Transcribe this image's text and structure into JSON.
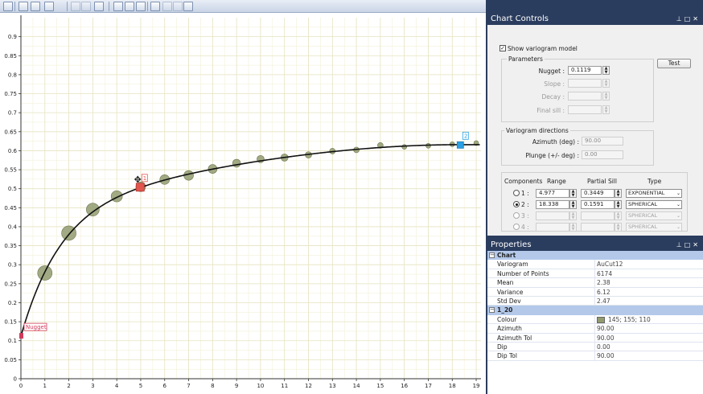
{
  "toolbar": {
    "buttons": [
      "layout-icon",
      "properties-icon",
      "chart-type-icon",
      "grid-icon",
      "copy-icon",
      "paste-icon",
      "export-icon",
      "select-pointer-icon",
      "pan-hand-icon",
      "zoom-icon",
      "variogram-icon",
      "undo-icon",
      "redo-icon",
      "fit-icon"
    ]
  },
  "chart_data": {
    "type": "scatter",
    "title": "",
    "xlabel": "",
    "ylabel": "",
    "xlim": [
      0,
      19.2
    ],
    "ylim": [
      0,
      0.95
    ],
    "x_ticks": [
      0,
      1,
      2,
      3,
      4,
      5,
      6,
      7,
      8,
      9,
      10,
      11,
      12,
      13,
      14,
      15,
      16,
      17,
      18,
      19
    ],
    "y_ticks": [
      0,
      0.05,
      0.1,
      0.15,
      0.2,
      0.25,
      0.3,
      0.35,
      0.4,
      0.45,
      0.5,
      0.55,
      0.6,
      0.65,
      0.7,
      0.75,
      0.8,
      0.85,
      0.9
    ],
    "grid": true,
    "point_color": "#919b6e",
    "series": [
      {
        "x": [
          1.0,
          2.0,
          3.0,
          4.0,
          5.0,
          6.0,
          7.0,
          8.0,
          9.0,
          10.0,
          11.0,
          12.0,
          13.0,
          14.0,
          15.0,
          16.0,
          17.0,
          18.0,
          19.0
        ],
        "y": [
          0.278,
          0.383,
          0.445,
          0.48,
          0.505,
          0.524,
          0.535,
          0.552,
          0.567,
          0.578,
          0.582,
          0.589,
          0.599,
          0.602,
          0.614,
          0.61,
          0.613,
          0.617,
          0.62
        ],
        "size": [
          9,
          9,
          8,
          7,
          6,
          6,
          6,
          5.5,
          5,
          4.5,
          4.5,
          4,
          3.5,
          3.5,
          3.5,
          3,
          3,
          3,
          3
        ]
      }
    ],
    "model": {
      "nugget": 0.1119,
      "structures": [
        {
          "type": "exponential",
          "range": 4.977,
          "sill": 0.3449
        },
        {
          "type": "spherical",
          "range": 18.338,
          "sill": 0.1591
        }
      ],
      "color": "#111111"
    },
    "annotations": [
      {
        "text": "Nugget",
        "x": 0.0,
        "y": 0.1119,
        "color": "#d33a5a"
      },
      {
        "text": "1",
        "x": 4.977,
        "y": 0.504,
        "color": "#e2554e"
      },
      {
        "text": "2",
        "x": 18.338,
        "y": 0.615,
        "color": "#2aa1e4"
      }
    ]
  },
  "chart_controls": {
    "title": "Chart Controls",
    "show_model_label": "Show variogram model",
    "show_model_checked": true,
    "test_label": "Test",
    "parameters_label": "Parameters",
    "nugget_label": "Nugget :",
    "nugget_value": "0.1119",
    "slope_label": "Slope :",
    "decay_label": "Decay :",
    "final_sill_label": "Final sill :",
    "directions_label": "Variogram directions",
    "azimuth_label": "Azimuth (deg) :",
    "azimuth_value": "90.00",
    "plunge_label": "Plunge (+/- deg) :",
    "plunge_value": "0.00",
    "components_label": "Components",
    "range_header": "Range",
    "partial_sill_header": "Partial Sill",
    "type_header": "Type",
    "components": [
      {
        "label": "1 :",
        "range": "4.977",
        "sill": "0.3449",
        "type": "EXPONENTIAL",
        "selected": false,
        "enabled": true
      },
      {
        "label": "2 :",
        "range": "18.338",
        "sill": "0.1591",
        "type": "SPHERICAL",
        "selected": true,
        "enabled": true
      },
      {
        "label": "3 :",
        "range": "",
        "sill": "",
        "type": "SPHERICAL",
        "selected": false,
        "enabled": false
      },
      {
        "label": "4 :",
        "range": "",
        "sill": "",
        "type": "SPHERICAL",
        "selected": false,
        "enabled": false
      }
    ]
  },
  "properties": {
    "title": "Properties",
    "categories": [
      {
        "name": "Chart",
        "rows": [
          {
            "key": "Variogram",
            "value": "AuCut12"
          },
          {
            "key": "Number of Points",
            "value": "6174"
          },
          {
            "key": "Mean",
            "value": "2.38"
          },
          {
            "key": "Variance",
            "value": "6.12"
          },
          {
            "key": "Std Dev",
            "value": "2.47"
          }
        ]
      },
      {
        "name": "1_20",
        "rows": [
          {
            "key": "Colour",
            "value": "145; 155; 110",
            "swatch": "#919b6e"
          },
          {
            "key": "Azimuth",
            "value": "90.00"
          },
          {
            "key": "Azimuth Tol",
            "value": "90.00"
          },
          {
            "key": "Dip",
            "value": "0.00"
          },
          {
            "key": "Dip Tol",
            "value": "90.00"
          }
        ]
      }
    ]
  }
}
